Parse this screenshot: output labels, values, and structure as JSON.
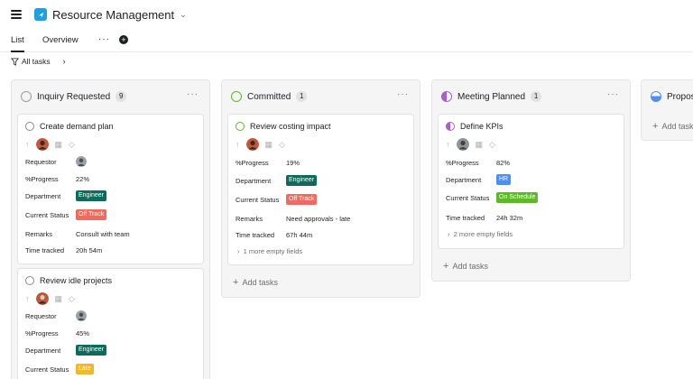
{
  "header": {
    "project_title": "Resource Management",
    "project_icon": "checkmark-icon",
    "brand_color": "#1f9ee0"
  },
  "tabs": [
    {
      "label": "List",
      "active": true
    },
    {
      "label": "Overview",
      "active": false
    }
  ],
  "filter": {
    "label": "All tasks"
  },
  "field_labels": {
    "requestor": "Requestor",
    "progress": "%Progress",
    "department": "Department",
    "status": "Current Status",
    "remarks": "Remarks",
    "time": "Time tracked"
  },
  "columns": [
    {
      "title": "Inquiry Requested",
      "count": "9",
      "cards": [
        {
          "title": "Create demand plan",
          "progress": "22%",
          "department": "Engineer",
          "status": "Off Track",
          "remarks": "Consult with team",
          "time": "20h 54m"
        },
        {
          "title": "Review idle projects",
          "progress": "45%",
          "department": "Engineer",
          "status": "Late"
        }
      ]
    },
    {
      "title": "Committed",
      "count": "1",
      "cards": [
        {
          "title": "Review costing impact",
          "progress": "19%",
          "department": "Engineer",
          "status": "Off Track",
          "remarks": "Need approvals - late",
          "time": "67h 44m",
          "more": "1 more empty fields"
        }
      ],
      "add_tasks": "Add tasks"
    },
    {
      "title": "Meeting Planned",
      "count": "1",
      "cards": [
        {
          "title": "Define KPIs",
          "progress": "82%",
          "department": "HR",
          "status": "On Schedule",
          "time": "24h 32m",
          "more": "2 more empty fields"
        }
      ],
      "add_tasks": "Add tasks"
    },
    {
      "title": "Propos",
      "add_tasks": "Add task"
    }
  ],
  "colors": {
    "engineer": "#0d6b5b",
    "hr": "#4f8ff0",
    "off_track": "#f06a5e",
    "late": "#f1b82d",
    "on_schedule": "#5cba29",
    "committed_ring": "#5cba29",
    "meeting_ring": "#a660c9"
  }
}
